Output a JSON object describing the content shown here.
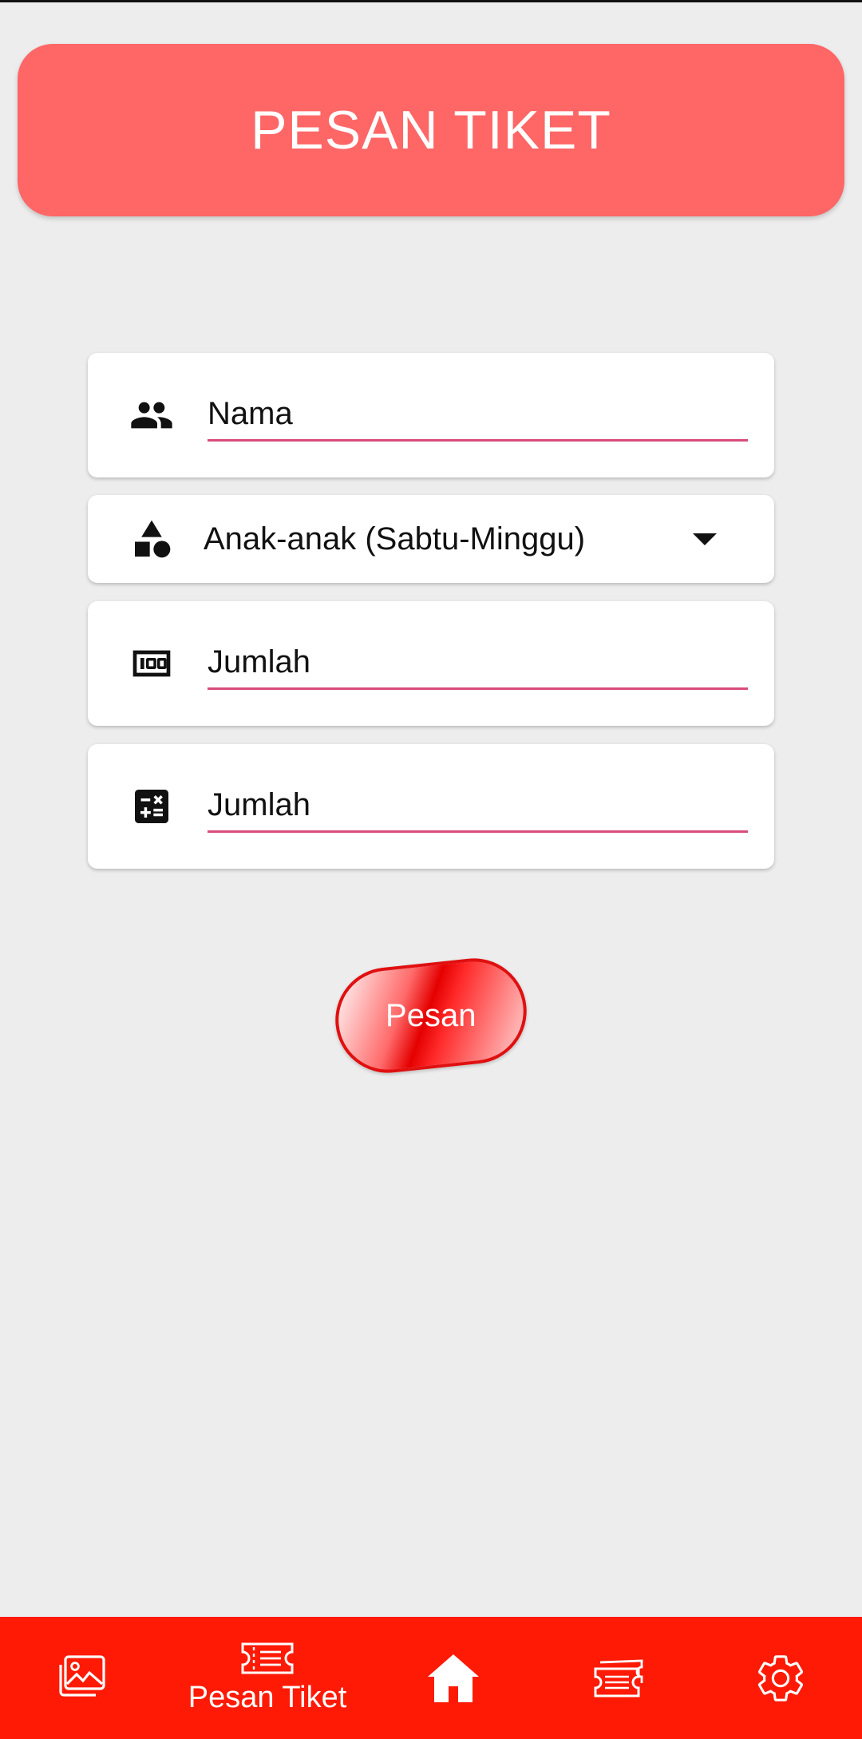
{
  "header": {
    "title": "PESAN TIKET"
  },
  "form": {
    "name_placeholder": "Nama",
    "category_selected": "Anak-anak (Sabtu-Minggu)",
    "quantity_placeholder": "Jumlah",
    "total_placeholder": "Jumlah"
  },
  "actions": {
    "order_label": "Pesan"
  },
  "bottom_nav": {
    "items": [
      {
        "icon": "gallery-icon",
        "label": ""
      },
      {
        "icon": "ticket-icon",
        "label": "Pesan Tiket"
      },
      {
        "icon": "home-icon",
        "label": ""
      },
      {
        "icon": "tickets-icon",
        "label": ""
      },
      {
        "icon": "gear-icon",
        "label": ""
      }
    ]
  },
  "colors": {
    "header_bg": "#ff6666",
    "nav_bg": "#ff1a06",
    "underline": "#d94c7a",
    "background": "#ededed"
  }
}
